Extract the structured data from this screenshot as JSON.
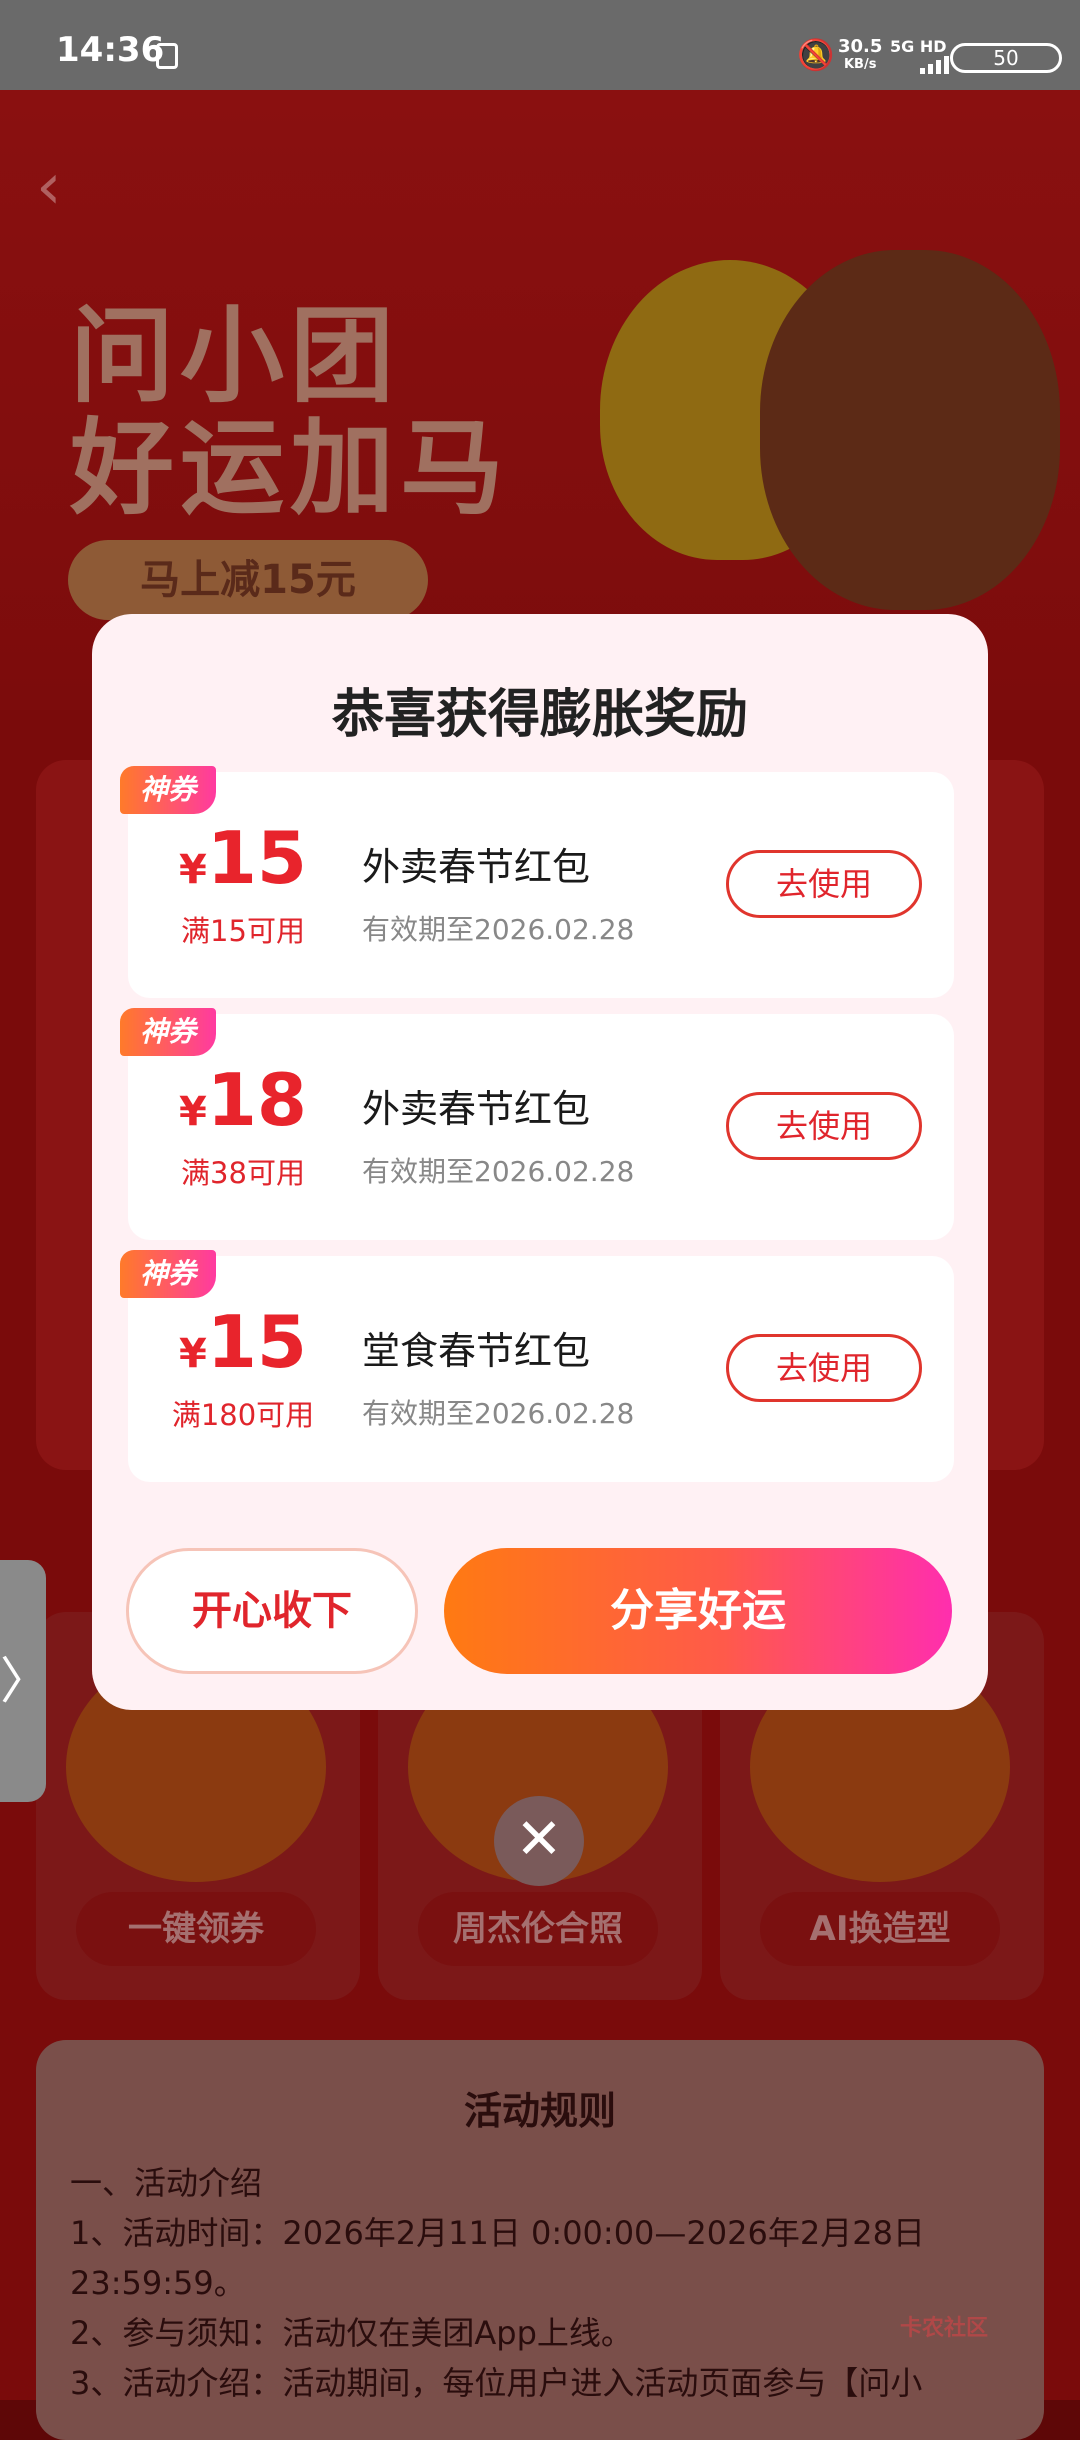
{
  "status_bar": {
    "time": "14:36",
    "speed_value": "30.5",
    "speed_unit": "KB/s",
    "network": "5G HD",
    "battery": "50"
  },
  "background": {
    "title_line1": "问小团",
    "title_line2": "好运加马",
    "promo": "马上减15元",
    "tools": [
      "一键领券",
      "周杰伦合照",
      "AI换造型"
    ],
    "rules_title": "活动规则",
    "rules_lines": [
      "一、活动介绍",
      "1、活动时间：2026年2月11日 0:00:00—2026年2月28日",
      "23:59:59。",
      "2、参与须知：活动仅在美团App上线。",
      "3、活动介绍：活动期间，每位用户进入活动页面参与【问小"
    ],
    "side_tab": "〉",
    "watermark": "卡农社区"
  },
  "modal": {
    "title": "恭喜获得膨胀奖励",
    "coupons": [
      {
        "badge": "神券",
        "currency": "¥",
        "amount": "15",
        "condition": "满15可用",
        "name": "外卖春节红包",
        "validity": "有效期至2026.02.28",
        "button": "去使用"
      },
      {
        "badge": "神券",
        "currency": "¥",
        "amount": "18",
        "condition": "满38可用",
        "name": "外卖春节红包",
        "validity": "有效期至2026.02.28",
        "button": "去使用"
      },
      {
        "badge": "神券",
        "currency": "¥",
        "amount": "15",
        "condition": "满180可用",
        "name": "堂食春节红包",
        "validity": "有效期至2026.02.28",
        "button": "去使用"
      }
    ],
    "keep_button": "开心收下",
    "share_button": "分享好运",
    "close_icon": "close-icon"
  },
  "colors": {
    "accent_red": "#e0252c",
    "share_gradient_start": "#ff7a12",
    "share_gradient_end": "#ff2eae",
    "modal_bg": "#fff1f4"
  }
}
